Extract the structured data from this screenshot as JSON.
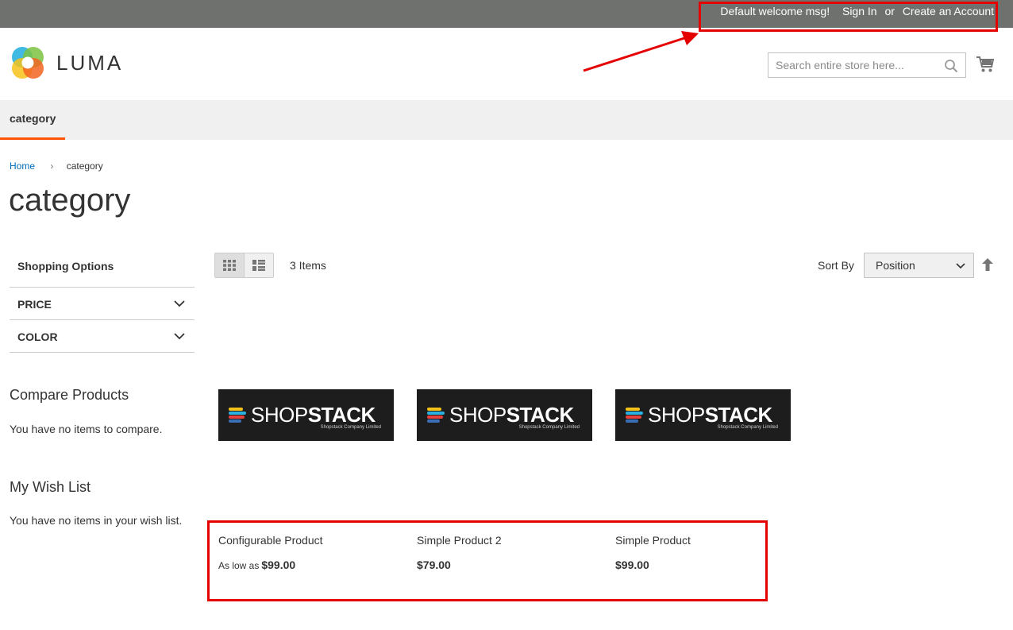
{
  "header": {
    "welcome": "Default welcome msg!",
    "sign_in": "Sign In",
    "or": "or",
    "create_account": "Create an Account"
  },
  "logo": {
    "text": "LUMA"
  },
  "search": {
    "placeholder": "Search entire store here..."
  },
  "nav": {
    "items": [
      {
        "label": "category"
      }
    ]
  },
  "breadcrumb": {
    "home": "Home",
    "current": "category"
  },
  "page": {
    "title": "category"
  },
  "sidebar": {
    "shopping_options": "Shopping Options",
    "filters": [
      {
        "label": "PRICE"
      },
      {
        "label": "COLOR"
      }
    ],
    "compare_title": "Compare Products",
    "compare_empty": "You have no items to compare.",
    "wishlist_title": "My Wish List",
    "wishlist_empty": "You have no items in your wish list."
  },
  "toolbar": {
    "items_count": "3 Items",
    "sort_label": "Sort By",
    "sort_value": "Position"
  },
  "products": [
    {
      "name": "Configurable Product",
      "price_label": "As low as",
      "price": "$99.00"
    },
    {
      "name": "Simple Product 2",
      "price_label": "",
      "price": "$79.00"
    },
    {
      "name": "Simple Product",
      "price_label": "",
      "price": "$99.00"
    }
  ],
  "product_image": {
    "brand_a": "SHOP",
    "brand_b": "STACK",
    "tagline": "Shopstack Company Limited"
  },
  "colors": {
    "header_bg": "#6e716e",
    "nav_accent": "#ff5501",
    "link": "#006bb4",
    "annotation": "#e50000"
  }
}
